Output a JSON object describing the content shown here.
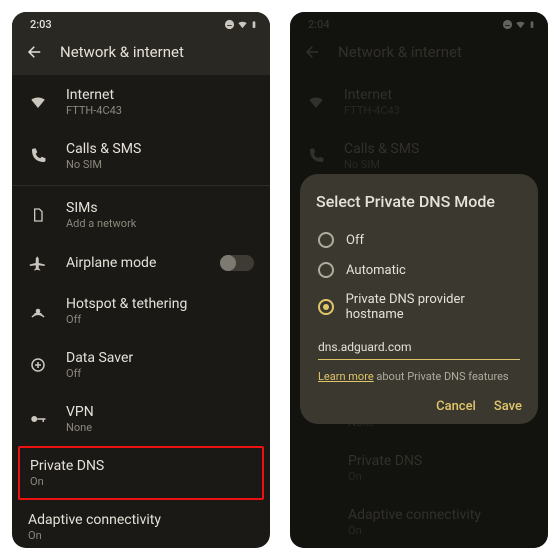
{
  "left": {
    "time": "2:03",
    "page_title": "Network & internet",
    "rows": {
      "internet": {
        "label": "Internet",
        "sub": "FTTH-4C43"
      },
      "calls": {
        "label": "Calls & SMS",
        "sub": "No SIM"
      },
      "sims": {
        "label": "SIMs",
        "sub": "Add a network"
      },
      "airplane": {
        "label": "Airplane mode"
      },
      "hotspot": {
        "label": "Hotspot & tethering",
        "sub": "Off"
      },
      "datasaver": {
        "label": "Data Saver",
        "sub": "Off"
      },
      "vpn": {
        "label": "VPN",
        "sub": "None"
      },
      "pdns": {
        "label": "Private DNS",
        "sub": "On"
      },
      "adaptive": {
        "label": "Adaptive connectivity",
        "sub": "On"
      }
    }
  },
  "right": {
    "time": "2:04",
    "page_title": "Network & internet",
    "rows": {
      "internet": {
        "label": "Internet",
        "sub": "FTTH-4C43"
      },
      "calls": {
        "label": "Calls & SMS",
        "sub": "No SIM"
      },
      "vpn_sub": "None",
      "pdns": {
        "label": "Private DNS",
        "sub": "On"
      },
      "adaptive": {
        "label": "Adaptive connectivity",
        "sub": "On"
      }
    },
    "dialog": {
      "title": "Select Private DNS Mode",
      "opt_off": "Off",
      "opt_auto": "Automatic",
      "opt_host": "Private DNS provider hostname",
      "hostname": "dns.adguard.com",
      "learn_link": "Learn more",
      "learn_rest": " about Private DNS features",
      "cancel": "Cancel",
      "save": "Save"
    }
  }
}
